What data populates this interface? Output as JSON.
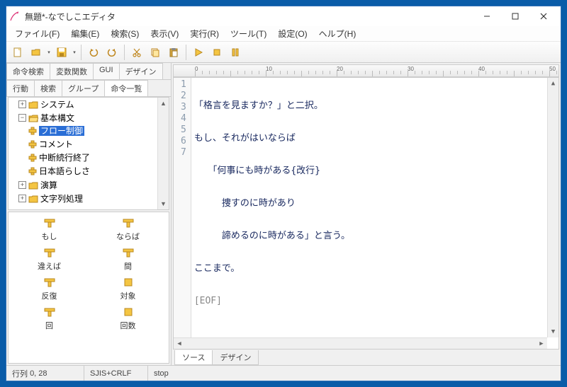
{
  "window": {
    "title": "無題*-なでしこエディタ"
  },
  "menu": {
    "file": "ファイル(F)",
    "edit": "編集(E)",
    "search": "検索(S)",
    "view": "表示(V)",
    "run": "実行(R)",
    "tools": "ツール(T)",
    "settings": "設定(O)",
    "help": "ヘルプ(H)"
  },
  "toolbar_icons": {
    "new": "new-file-icon",
    "open": "open-folder-icon",
    "save": "save-icon",
    "undo": "undo-icon",
    "redo": "redo-icon",
    "cut": "cut-icon",
    "copy": "copy-icon",
    "paste": "paste-icon",
    "run": "play-icon",
    "stop": "stop-icon",
    "pause": "pause-icon"
  },
  "left_tabs_top": {
    "cmd_search": "命令検索",
    "var_func": "変数関数",
    "gui": "GUI",
    "design": "デザイン"
  },
  "left_tabs_bottom": {
    "action": "行動",
    "search": "検索",
    "group": "グループ",
    "cmd_list": "命令一覧"
  },
  "tree": {
    "system": "システム",
    "basic_syntax": "基本構文",
    "flow_control": "フロー制御",
    "comment": "コメント",
    "abort_continue": "中断続行終了",
    "japanese_likeness": "日本語らしさ",
    "operation": "演算",
    "string_proc": "文字列処理"
  },
  "palette": {
    "moshi": "もし",
    "naraba": "ならば",
    "chigaeba": "違えば",
    "aida": "間",
    "hanpuku": "反復",
    "taishou": "対象",
    "kai": "回",
    "kaisuu": "回数"
  },
  "ruler_ticks": [
    "0",
    "10",
    "20",
    "30",
    "40",
    "50"
  ],
  "editor": {
    "line_numbers": [
      "1",
      "2",
      "3",
      "4",
      "5",
      "6",
      "7"
    ],
    "lines": [
      "「格言を見ますか？」と二択。",
      "もし、それがはいならば",
      "　　「何事にも時がある{改行}",
      "　　　捜すのに時があり",
      "　　　諦めるのに時がある」と言う。",
      "ここまで。",
      "[EOF]"
    ]
  },
  "bottom_tabs": {
    "source": "ソース",
    "design": "デザイン"
  },
  "status": {
    "pos_label": "行列",
    "pos_value": "0, 28",
    "encoding": "SJIS+CRLF",
    "state": "stop"
  }
}
